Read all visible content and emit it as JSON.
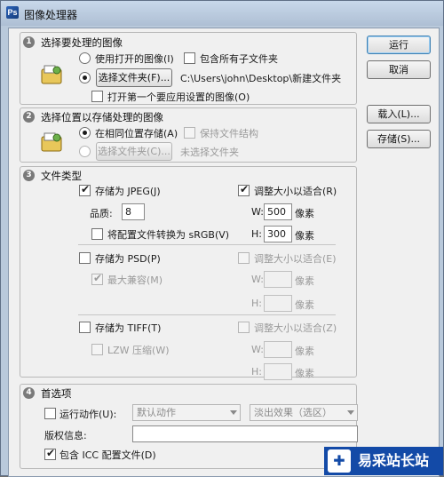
{
  "window": {
    "title": "图像处理器"
  },
  "buttons": {
    "run": "运行",
    "cancel": "取消",
    "load": "载入(L)...",
    "save": "存储(S)..."
  },
  "section1": {
    "number": "1",
    "title": "选择要处理的图像",
    "use_open_images": "使用打开的图像(I)",
    "include_subfolders": "包含所有子文件夹",
    "select_folder_button": "选择文件夹(F)...",
    "folder_path": "C:\\Users\\john\\Desktop\\新建文件夹",
    "open_first_image": "打开第一个要应用设置的图像(O)"
  },
  "section2": {
    "number": "2",
    "title": "选择位置以存储处理的图像",
    "save_same_location": "在相同位置存储(A)",
    "keep_structure": "保持文件结构",
    "select_folder_button": "选择文件夹(C)...",
    "no_folder": "未选择文件夹"
  },
  "section3": {
    "number": "3",
    "title": "文件类型",
    "jpeg": {
      "save_label": "存储为 JPEG(J)",
      "resize_label": "调整大小以适合(R)",
      "quality_label": "品质:",
      "quality_value": "8",
      "w_label": "W:",
      "w_value": "500",
      "h_label": "H:",
      "h_value": "300",
      "unit": "像素",
      "convert_srgb": "将配置文件转换为 sRGB(V)"
    },
    "psd": {
      "save_label": "存储为 PSD(P)",
      "resize_label": "调整大小以适合(E)",
      "max_compat": "最大兼容(M)",
      "w_label": "W:",
      "h_label": "H:",
      "unit": "像素"
    },
    "tiff": {
      "save_label": "存储为 TIFF(T)",
      "resize_label": "调整大小以适合(Z)",
      "lzw": "LZW 压缩(W)",
      "w_label": "W:",
      "h_label": "H:",
      "unit": "像素"
    }
  },
  "section4": {
    "number": "4",
    "title": "首选项",
    "run_action": "运行动作(U):",
    "action_set": "默认动作",
    "action": "淡出效果（选区）",
    "copyright_label": "版权信息:",
    "include_icc": "包含 ICC 配置文件(D)"
  },
  "watermark": {
    "text": "易采站长站"
  },
  "colors": {
    "titlebar": "#b9c9db",
    "panel": "#f0f0f0",
    "watermark": "#134aa7"
  }
}
